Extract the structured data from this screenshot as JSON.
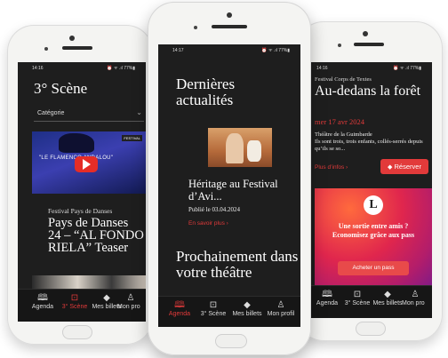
{
  "tabs": [
    {
      "label": "Agenda",
      "icon": "book-icon"
    },
    {
      "label": "3° Scène",
      "icon": "play-square-icon"
    },
    {
      "label": "Mes billets",
      "icon": "ticket-icon"
    },
    {
      "label": "Mon profil",
      "icon": "user-icon"
    }
  ],
  "left": {
    "status_time": "14:16",
    "status_right": "⏰ ᯤ .ıl 77%▮",
    "title": "3° Scène",
    "category_label": "Catégorie",
    "video_banner": "\"LE FLAMENCO ANDALOU\"",
    "video_logo": "FESTIVAL",
    "event_category": "Festival Pays de Danses",
    "event_title": "Pays de Danses 24 – “AL FONDO RIELA” Teaser",
    "tabs_visible": [
      "Agenda",
      "3° Scène",
      "Mes billets",
      "Mon pro"
    ]
  },
  "center": {
    "status_time": "14:17",
    "status_right": "⏰ ᯤ .ıl 77%▮",
    "section_title": "Dernières actualités",
    "news_title": "Héritage au Festival d’Avi...",
    "news_date": "Publié le 03.04.2024",
    "read_more": "En savoir plus  ›",
    "next_section": "Prochainement dans votre théâtre",
    "tabs_visible": [
      "Agenda",
      "3° Scène",
      "Mes billets",
      "Mon profil"
    ]
  },
  "right": {
    "status_time": "14:16",
    "status_right": "⏰ ᯤ .ıl 77%▮",
    "category": "Festival Corps de Textes",
    "title": "Au-dedans la forêt",
    "date": "mer 17 avr 2024",
    "venue": "Théâtre de la Guimbarde",
    "excerpt": "Ils sont trois, trois enfants, collés-serrés depuis qu’ils se so...",
    "more_info": "Plus d’infos  ›",
    "reserve": "Réserver",
    "promo_logo": "L",
    "promo_text": "Une sortie entre amis ? Economisez grâce aux pass",
    "promo_button": "Acheter un pass",
    "tabs_visible": [
      "Agenda",
      "3° Scène",
      "Mes billets",
      "Mon pro"
    ]
  },
  "colors": {
    "accent": "#e23a3a",
    "screen_bg": "#1e1e1e"
  }
}
